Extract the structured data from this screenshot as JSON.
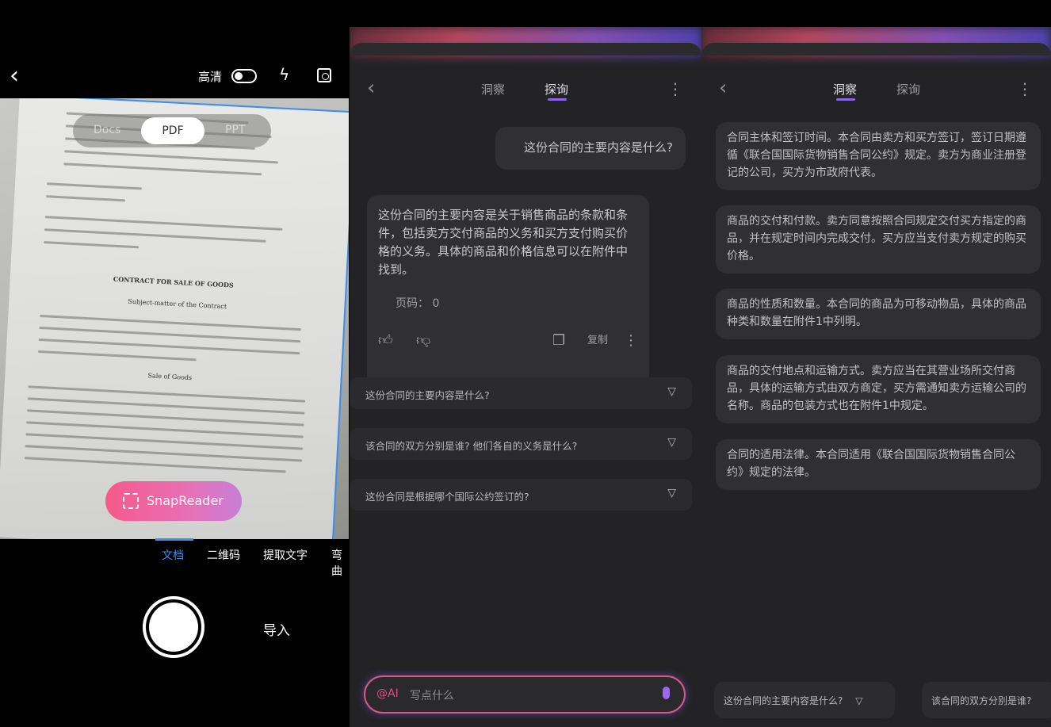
{
  "camera": {
    "hd_label": "高清",
    "modes": [
      "Docs",
      "PDF",
      "PPT"
    ],
    "doc_title": "CONTRACT FOR SALE OF GOODS",
    "doc_subtitle": "Subject-matter of the Contract",
    "doc_section": "Sale of Goods",
    "snap_label": "SnapReader",
    "tabs": [
      "文档",
      "二维码",
      "提取文字",
      "弯曲"
    ],
    "import_label": "导入"
  },
  "chat": {
    "tabs": [
      "洞察",
      "探询"
    ],
    "user_question": "这份合同的主要内容是什么?",
    "answer": "这份合同的主要内容是关于销售商品的条款和条件，包括卖方交付商品的义务和买方支付购买价格的义务。具体的商品和价格信息可以在附件中找到。",
    "page_label": "页码：",
    "page_value": "0",
    "copy_label": "复制",
    "suggestions": [
      "这份合同的主要内容是什么?",
      "该合同的双方分别是谁? 他们各自的义务是什么?",
      "这份合同是根据哪个国际公约签订的?"
    ],
    "input_prefix": "@AI",
    "input_placeholder": "写点什么"
  },
  "insight": {
    "cards": [
      "合同主体和签订时间。本合同由卖方和买方签订，签订日期遵循《联合国国际货物销售合同公约》规定。卖方为商业注册登记的公司，买方为市政府代表。",
      "商品的交付和付款。卖方同意按照合同规定交付买方指定的商品，并在规定时间内完成交付。买方应当支付卖方规定的购买价格。",
      "商品的性质和数量。本合同的商品为可移动物品，具体的商品种类和数量在附件1中列明。",
      "商品的交付地点和运输方式。卖方应当在其营业场所交付商品，具体的运输方式由双方商定，买方需通知卖方运输公司的名称。商品的包装方式也在附件1中规定。",
      "合同的适用法律。本合同适用《联合国国际货物销售合同公约》规定的法律。"
    ],
    "chips": [
      "这份合同的主要内容是什么?",
      "该合同的双方分别是谁?"
    ]
  }
}
